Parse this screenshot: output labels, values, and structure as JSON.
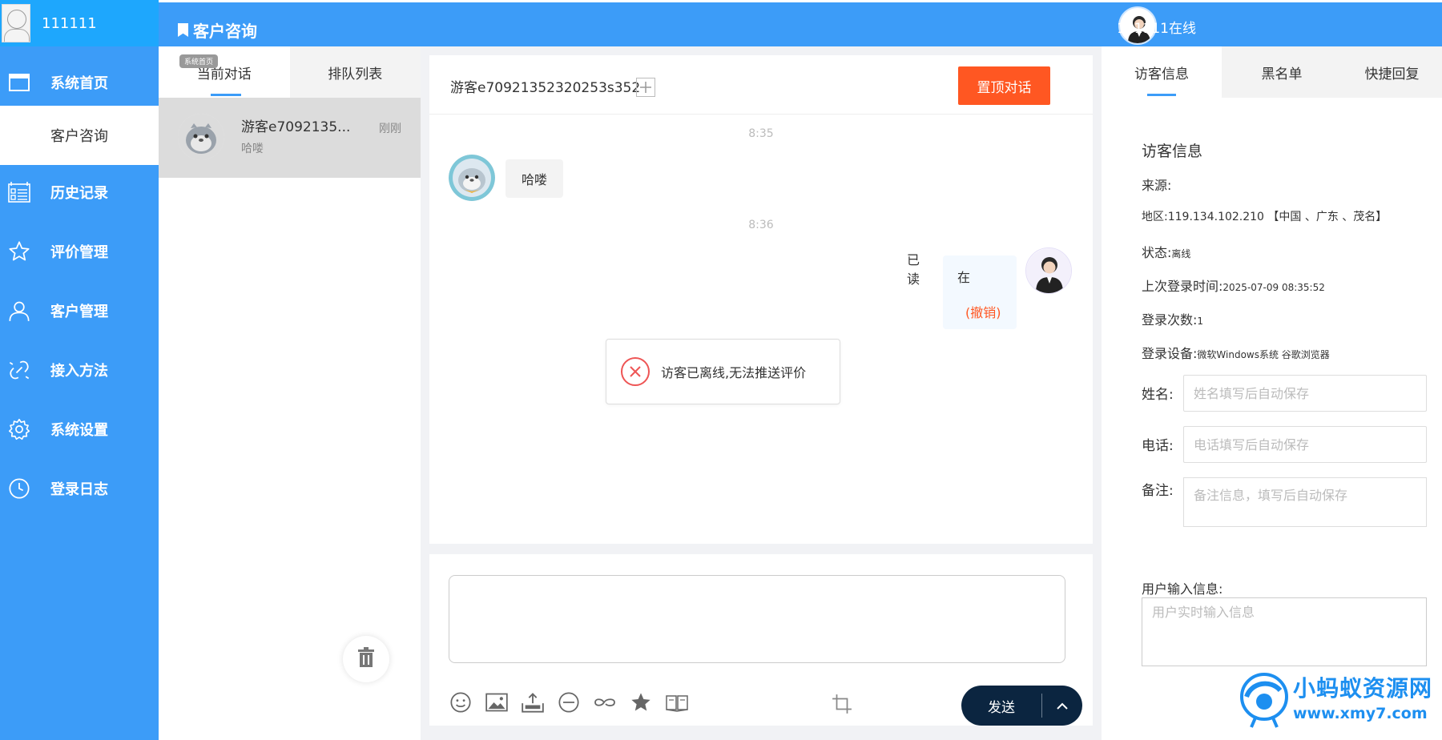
{
  "app": {
    "username": "111111",
    "page_title": "客户咨询",
    "agent_status": "111111在线"
  },
  "sidebar": {
    "items": [
      {
        "label": "系统首页",
        "icon": "window-icon"
      },
      {
        "label": "客户咨询",
        "icon": "",
        "active": true
      },
      {
        "label": "历史记录",
        "icon": "list-icon"
      },
      {
        "label": "评价管理",
        "icon": "star-icon"
      },
      {
        "label": "客户管理",
        "icon": "user-icon"
      },
      {
        "label": "接入方法",
        "icon": "link-icon"
      },
      {
        "label": "系统设置",
        "icon": "gear-icon"
      },
      {
        "label": "登录日志",
        "icon": "clock-icon"
      }
    ]
  },
  "list_panel": {
    "tabs": [
      "当前对话",
      "排队列表"
    ],
    "tooltip": "系统首页",
    "conversations": [
      {
        "name": "游客e7092135...",
        "time": "刚刚",
        "last_message": "哈喽"
      }
    ]
  },
  "chat": {
    "visitor_id": "游客e70921352320253s352",
    "pin_label": "置顶对话",
    "messages": [
      {
        "time": "8:35",
        "from": "visitor",
        "text": "哈喽"
      },
      {
        "time": "8:36",
        "from": "agent",
        "text": "在",
        "read": "已读",
        "recall": "(撤销)"
      }
    ],
    "toast": "访客已离线,无法推送评价"
  },
  "input": {
    "send_label": "发送",
    "value": ""
  },
  "right_panel": {
    "tabs": [
      "访客信息",
      "黑名单",
      "快捷回复"
    ],
    "section_title": "访客信息",
    "info": {
      "source_label": "来源:",
      "source_value": "",
      "region_label": "地区:",
      "region_value": "119.134.102.210 【中国 、广东 、茂名】",
      "status_label": "状态:",
      "status_value": "离线",
      "last_login_label": "上次登录时间:",
      "last_login_value": "2025-07-09 08:35:52",
      "login_count_label": "登录次数:",
      "login_count_value": "1",
      "device_label": "登录设备:",
      "device_value": "微软Windows系统 谷歌浏览器"
    },
    "form": {
      "name_label": "姓名:",
      "name_placeholder": "姓名填写后自动保存",
      "phone_label": "电话:",
      "phone_placeholder": "电话填写后自动保存",
      "remark_label": "备注:",
      "remark_placeholder": "备注信息，填写后自动保存"
    },
    "user_input_label": "用户输入信息:",
    "user_input_placeholder": "用户实时输入信息"
  },
  "watermark": {
    "line1": "小蚂蚁资源网",
    "line2": "www.xmy7.com"
  },
  "colors": {
    "primary": "#3c9cf8",
    "brand": "#1ea7fd",
    "danger": "#ff5722",
    "send": "#0b2540"
  }
}
